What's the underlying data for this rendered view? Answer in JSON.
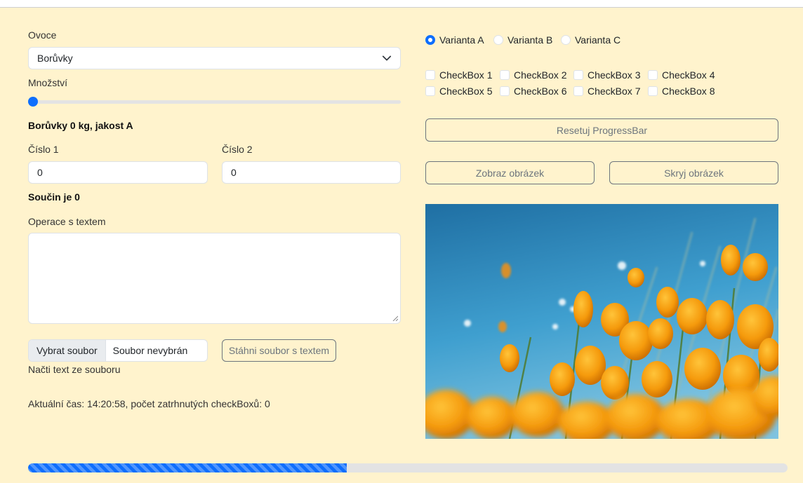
{
  "fruit": {
    "label": "Ovoce",
    "selected": "Borůvky"
  },
  "quantity": {
    "label": "Množství",
    "value": 0
  },
  "summary": "Borůvky 0 kg, jakost A",
  "numbers": {
    "label1": "Číslo 1",
    "value1": "0",
    "label2": "Číslo 2",
    "value2": "0"
  },
  "product": "Součin je 0",
  "text_ops": {
    "label": "Operace s textem",
    "value": ""
  },
  "file": {
    "choose_label": "Vybrat soubor",
    "status": "Soubor nevybrán",
    "download_label": "Stáhni soubor s textem",
    "load_label": "Načti text ze souboru"
  },
  "status_line": "Aktuální čas: 14:20:58, počet zatrhnutých checkBoxů: 0",
  "radios": [
    {
      "label": "Varianta A",
      "checked": true
    },
    {
      "label": "Varianta B",
      "checked": false
    },
    {
      "label": "Varianta C",
      "checked": false
    }
  ],
  "checkboxes": [
    "CheckBox 1",
    "CheckBox 2",
    "CheckBox 3",
    "CheckBox 4",
    "CheckBox 5",
    "CheckBox 6",
    "CheckBox 7",
    "CheckBox 8"
  ],
  "buttons": {
    "reset": "Resetuj ProgressBar",
    "show": "Zobraz obrázek",
    "hide": "Skryj obrázek"
  },
  "progress": {
    "value": 0.42
  },
  "colors": {
    "background": "#fff3cd",
    "accent": "#0d6efd",
    "outline": "#6c757d"
  }
}
